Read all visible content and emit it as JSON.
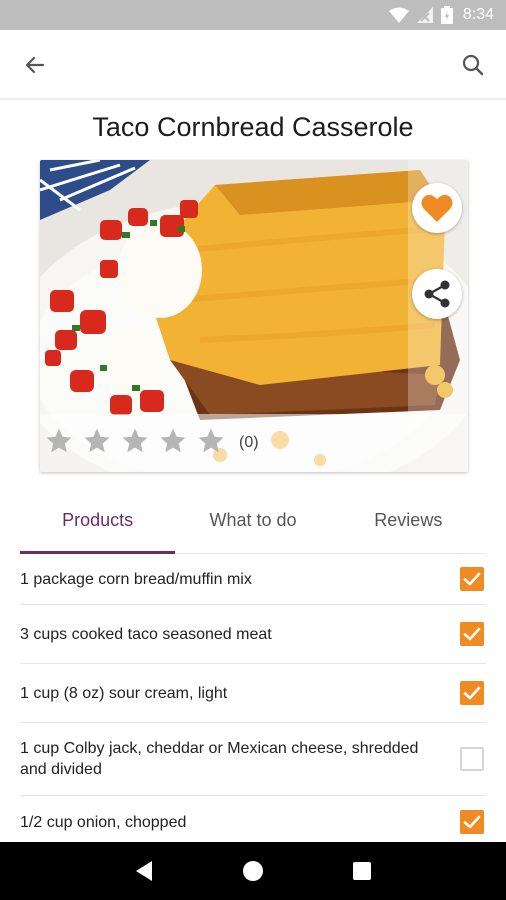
{
  "status_bar": {
    "time": "8:34"
  },
  "app_bar": {
    "back_icon": "arrow-back-icon",
    "search_icon": "search-icon"
  },
  "recipe": {
    "title": "Taco Cornbread Casserole",
    "rating": {
      "value": 0,
      "max": 5,
      "count_label": "(0)"
    },
    "favorited": true
  },
  "colors": {
    "accent": "#f08b24",
    "tab_active": "#6b2e63"
  },
  "tabs": [
    {
      "label": "Products",
      "active": true
    },
    {
      "label": "What to do",
      "active": false
    },
    {
      "label": "Reviews",
      "active": false
    }
  ],
  "ingredients": [
    {
      "text": "1 package corn bread/muffin mix",
      "checked": true
    },
    {
      "text": "3 cups cooked taco seasoned meat",
      "checked": true
    },
    {
      "text": "1 cup (8 oz) sour cream, light",
      "checked": true
    },
    {
      "text": "1 cup Colby jack, cheddar or Mexican cheese, shredded and divided",
      "checked": false
    },
    {
      "text": "1/2 cup onion, chopped",
      "checked": true
    }
  ],
  "nav": {
    "back": "nav-back-icon",
    "home": "nav-home-icon",
    "recents": "nav-recents-icon"
  }
}
